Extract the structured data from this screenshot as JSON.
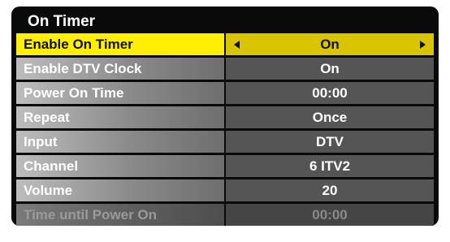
{
  "menu": {
    "title": "On Timer",
    "rows": [
      {
        "label": "Enable On Timer",
        "value": "On"
      },
      {
        "label": "Enable DTV Clock",
        "value": "On"
      },
      {
        "label": "Power On Time",
        "value": "00:00"
      },
      {
        "label": "Repeat",
        "value": "Once"
      },
      {
        "label": "Input",
        "value": "DTV"
      },
      {
        "label": "Channel",
        "value": "6 ITV2"
      },
      {
        "label": "Volume",
        "value": "20"
      },
      {
        "label": "Time until Power On",
        "value": "00:00"
      }
    ]
  },
  "colors": {
    "panel_background": "#0a0a0a",
    "selected_label": "#ffef00",
    "selected_value": "#d9c400",
    "value_cell": "#555555",
    "disabled_text": "#9a9a9a"
  },
  "icons": {
    "decrease": "left-arrow-icon",
    "increase": "right-arrow-icon"
  }
}
